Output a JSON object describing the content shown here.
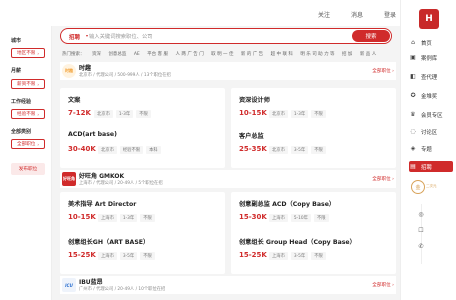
{
  "topbar": {
    "links": [
      "关注",
      "消息",
      "登录"
    ]
  },
  "search": {
    "label": "招聘",
    "placeholder": "输入关键词搜索职位、公司",
    "button": "搜索"
  },
  "hot": {
    "label": "热门搜索：",
    "keywords": [
      "资深",
      "创意总监",
      "AE",
      "平台 客 服",
      "人 两 广 告 门",
      "取 明 一 佳",
      "新 的 广 告",
      "超 中 联 科",
      "明 乐 司 助 力 等",
      "招 加",
      "新 品 人"
    ]
  },
  "filters": [
    {
      "title": "城市",
      "value": "地区不限"
    },
    {
      "title": "月薪",
      "value": "薪资不限"
    },
    {
      "title": "工作经验",
      "value": "经验不限"
    },
    {
      "title": "全部类别",
      "value": "全部职位"
    }
  ],
  "post_job": "发布职位",
  "companies": [
    {
      "logo": "时趣",
      "logo_color": "#f2a23a",
      "name": "时趣",
      "meta": "北京市 / 代理公司 / 500-999人 / 13个职位在招",
      "all": "全部职位",
      "jobs": [
        {
          "title": "文案",
          "salary": "7-12K",
          "tags": [
            "北京市",
            "1-3年",
            "不限"
          ]
        },
        {
          "title": "资深设计师",
          "salary": "10-15K",
          "tags": [
            "北京市",
            "1-3年",
            "不限"
          ]
        },
        {
          "title": "ACD(art base)",
          "salary": "30-40K",
          "tags": [
            "北京市",
            "经验不限",
            "本科"
          ]
        },
        {
          "title": "客户总监",
          "salary": "25-35K",
          "tags": [
            "北京市",
            "3-5年",
            "不限"
          ]
        }
      ]
    },
    {
      "logo": "好旺角",
      "logo_color": "#d02b2b",
      "name": "好旺角 GMKOK",
      "meta": "上海市 / 代理公司 / 20-49人 / 5个职位在招",
      "all": "全部职位",
      "jobs": [
        {
          "title": "美术指导 Art Director",
          "salary": "10-15K",
          "tags": [
            "上海市",
            "1-3年",
            "不限"
          ]
        },
        {
          "title": "创意副总监 ACD（Copy Base）",
          "salary": "15-30K",
          "tags": [
            "上海市",
            "5-10年",
            "不限"
          ]
        },
        {
          "title": "创意组长GH（ART BASE）",
          "salary": "15-25K",
          "tags": [
            "上海市",
            "3-5年",
            "不限"
          ]
        },
        {
          "title": "创意组长 Group Head（Copy Base）",
          "salary": "15-25K",
          "tags": [
            "上海市",
            "3-5年",
            "不限"
          ]
        }
      ]
    },
    {
      "logo": "ICU",
      "logo_color": "#2a6fd0",
      "name": "IBU蓝昂",
      "meta": "广州市 / 代理公司 / 20-49人 / 10个职位在招",
      "all": "全部职位",
      "jobs": []
    }
  ],
  "right_nav": {
    "brand": "H",
    "items": [
      {
        "icon": "⌂",
        "label": "首页"
      },
      {
        "icon": "▣",
        "label": "案例库"
      },
      {
        "icon": "◧",
        "label": "查代理"
      },
      {
        "icon": "✪",
        "label": "金堆奖"
      },
      {
        "icon": "♛",
        "label": "会员专区"
      },
      {
        "icon": "◌",
        "label": "讨论区"
      },
      {
        "icon": "◈",
        "label": "专题"
      },
      {
        "icon": "▤",
        "label": "招聘"
      }
    ],
    "gold_badge": "金",
    "gold_text": "二次元",
    "floating": [
      "◎",
      "☐",
      "✆"
    ]
  }
}
